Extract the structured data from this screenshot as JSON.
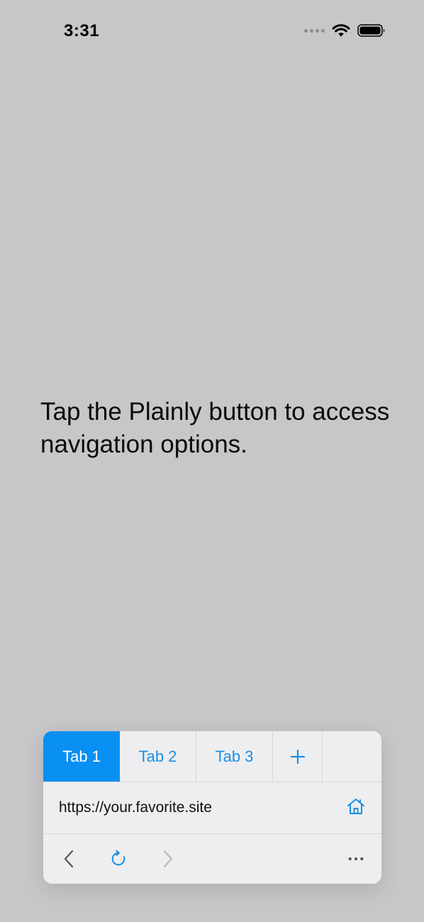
{
  "status_bar": {
    "time": "3:31"
  },
  "instruction": {
    "text": "Tap the Plainly button to access navigation options."
  },
  "browser": {
    "tabs": [
      {
        "label": "Tab 1",
        "active": true
      },
      {
        "label": "Tab 2",
        "active": false
      },
      {
        "label": "Tab 3",
        "active": false
      }
    ],
    "add_tab_icon": "plus-icon",
    "url": "https://your.favorite.site",
    "home_icon": "home-icon",
    "nav": {
      "back_icon": "chevron-left-icon",
      "reload_icon": "reload-icon",
      "forward_icon": "chevron-right-icon",
      "more_icon": "ellipsis-icon"
    }
  },
  "colors": {
    "background": "#c7c7c9",
    "accent": "#0a8ff3",
    "panel": "#eeeef0"
  }
}
